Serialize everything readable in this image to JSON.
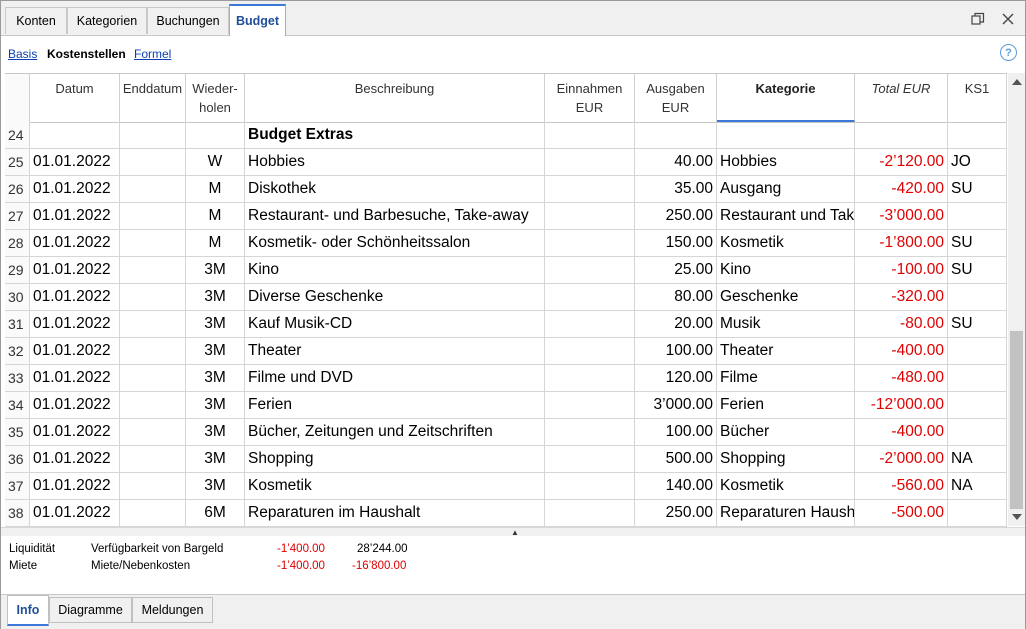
{
  "tabs": [
    "Konten",
    "Kategorien",
    "Buchungen",
    "Budget"
  ],
  "active_tab": "Budget",
  "views": {
    "basis": "Basis",
    "kostenstellen": "Kostenstellen",
    "formel": "Formel"
  },
  "help_label": "?",
  "columns": {
    "rownum": "",
    "datum": "Datum",
    "enddatum": "Enddatum",
    "wieder1": "Wieder-",
    "wieder2": "holen",
    "beschreibung": "Beschreibung",
    "einnahmen1": "Einnahmen",
    "einnahmen2": "EUR",
    "ausgaben1": "Ausgaben",
    "ausgaben2": "EUR",
    "kategorie": "Kategorie",
    "total": "Total EUR",
    "ks1": "KS1"
  },
  "rows": [
    {
      "n": "24",
      "datum": "",
      "end": "",
      "wdh": "",
      "besch": "Budget Extras",
      "ein": "",
      "aus": "",
      "kat": "",
      "tot": "",
      "ks1": "",
      "header": true
    },
    {
      "n": "25",
      "datum": "01.01.2022",
      "end": "",
      "wdh": "W",
      "besch": "Hobbies",
      "ein": "",
      "aus": "40.00",
      "kat": "Hobbies",
      "tot": "-2’120.00",
      "ks1": "JO"
    },
    {
      "n": "26",
      "datum": "01.01.2022",
      "end": "",
      "wdh": "M",
      "besch": "Diskothek",
      "ein": "",
      "aus": "35.00",
      "kat": "Ausgang",
      "tot": "-420.00",
      "ks1": "SU"
    },
    {
      "n": "27",
      "datum": "01.01.2022",
      "end": "",
      "wdh": "M",
      "besch": "Restaurant- und Barbesuche, Take-away",
      "ein": "",
      "aus": "250.00",
      "kat": "Restaurant und Take",
      "tot": "-3’000.00",
      "ks1": ""
    },
    {
      "n": "28",
      "datum": "01.01.2022",
      "end": "",
      "wdh": "M",
      "besch": "Kosmetik- oder Schönheitssalon",
      "ein": "",
      "aus": "150.00",
      "kat": "Kosmetik",
      "tot": "-1’800.00",
      "ks1": "SU"
    },
    {
      "n": "29",
      "datum": "01.01.2022",
      "end": "",
      "wdh": "3M",
      "besch": "Kino",
      "ein": "",
      "aus": "25.00",
      "kat": "Kino",
      "tot": "-100.00",
      "ks1": "SU"
    },
    {
      "n": "30",
      "datum": "01.01.2022",
      "end": "",
      "wdh": "3M",
      "besch": "Diverse Geschenke",
      "ein": "",
      "aus": "80.00",
      "kat": "Geschenke",
      "tot": "-320.00",
      "ks1": ""
    },
    {
      "n": "31",
      "datum": "01.01.2022",
      "end": "",
      "wdh": "3M",
      "besch": "Kauf Musik-CD",
      "ein": "",
      "aus": "20.00",
      "kat": "Musik",
      "tot": "-80.00",
      "ks1": "SU"
    },
    {
      "n": "32",
      "datum": "01.01.2022",
      "end": "",
      "wdh": "3M",
      "besch": "Theater",
      "ein": "",
      "aus": "100.00",
      "kat": "Theater",
      "tot": "-400.00",
      "ks1": ""
    },
    {
      "n": "33",
      "datum": "01.01.2022",
      "end": "",
      "wdh": "3M",
      "besch": "Filme und DVD",
      "ein": "",
      "aus": "120.00",
      "kat": "Filme",
      "tot": "-480.00",
      "ks1": ""
    },
    {
      "n": "34",
      "datum": "01.01.2022",
      "end": "",
      "wdh": "3M",
      "besch": "Ferien",
      "ein": "",
      "aus": "3’000.00",
      "kat": "Ferien",
      "tot": "-12’000.00",
      "ks1": ""
    },
    {
      "n": "35",
      "datum": "01.01.2022",
      "end": "",
      "wdh": "3M",
      "besch": "Bücher, Zeitungen und Zeitschriften",
      "ein": "",
      "aus": "100.00",
      "kat": "Bücher",
      "tot": "-400.00",
      "ks1": ""
    },
    {
      "n": "36",
      "datum": "01.01.2022",
      "end": "",
      "wdh": "3M",
      "besch": "Shopping",
      "ein": "",
      "aus": "500.00",
      "kat": "Shopping",
      "tot": "-2’000.00",
      "ks1": "NA"
    },
    {
      "n": "37",
      "datum": "01.01.2022",
      "end": "",
      "wdh": "3M",
      "besch": "Kosmetik",
      "ein": "",
      "aus": "140.00",
      "kat": "Kosmetik",
      "tot": "-560.00",
      "ks1": "NA"
    },
    {
      "n": "38",
      "datum": "01.01.2022",
      "end": "",
      "wdh": "6M",
      "besch": "Reparaturen im Haushalt",
      "ein": "",
      "aus": "250.00",
      "kat": "Reparaturen Haush",
      "tot": "-500.00",
      "ks1": ""
    }
  ],
  "info": [
    {
      "konto": "Liquidität",
      "beschreibung": "Verfügbarkeit von Bargeld",
      "betrag": "-1’400.00",
      "saldo": "28’244.00",
      "saldo_neg": false
    },
    {
      "konto": "Miete",
      "beschreibung": "Miete/Nebenkosten",
      "betrag": "-1’400.00",
      "saldo": "-16’800.00",
      "saldo_neg": true
    }
  ],
  "bottom_tabs": [
    "Info",
    "Diagramme",
    "Meldungen"
  ],
  "active_bottom_tab": "Info",
  "colors": {
    "negative": "#e00000",
    "accent": "#3c78d8",
    "link": "#0b3fb0"
  }
}
